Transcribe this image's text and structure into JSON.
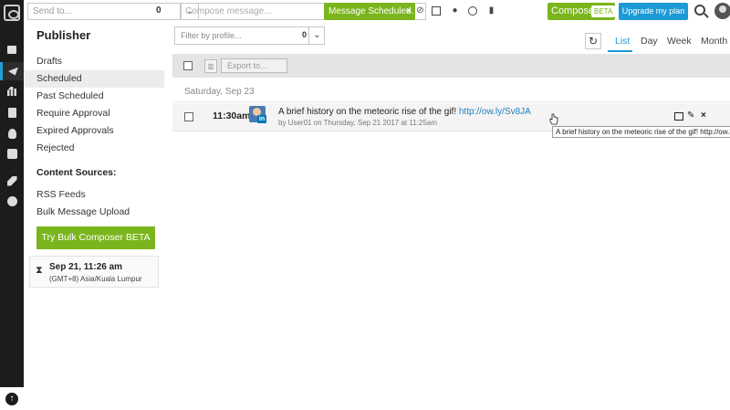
{
  "topbar": {
    "send_to_placeholder": "Send to...",
    "send_to_count": "0",
    "compose_placeholder": "Compose message...",
    "toast": "Message Scheduled.",
    "toast_close": "×",
    "composer_label": "Composer",
    "composer_badge": "BETA",
    "upgrade_label": "Upgrade my plan"
  },
  "sidebar": {
    "title": "Publisher",
    "items": [
      {
        "label": "Drafts"
      },
      {
        "label": "Scheduled"
      },
      {
        "label": "Past Scheduled"
      },
      {
        "label": "Require Approval"
      },
      {
        "label": "Expired Approvals"
      },
      {
        "label": "Rejected"
      }
    ],
    "active_item": "Scheduled",
    "content_sources_title": "Content Sources:",
    "sources": [
      {
        "label": "RSS Feeds"
      },
      {
        "label": "Bulk Message Upload"
      }
    ],
    "bulk_button": "Try Bulk Composer BETA",
    "timezone": {
      "datetime": "Sep 21, 11:26 am",
      "zone": "(GMT+8) Asia/Kuala Lumpur"
    }
  },
  "main": {
    "filter_placeholder": "Filter by profile...",
    "filter_count": "0",
    "views": [
      "List",
      "Day",
      "Week",
      "Month"
    ],
    "active_view": "List",
    "export_label": "Export to...",
    "day_header": "Saturday, Sep 23",
    "message": {
      "time": "11:30am",
      "text": "A brief history on the meteoric rise of the gif!",
      "link": "http://ow.ly/Sv8JA",
      "meta": "by User01 on Thursday, Sep 21 2017 at 11:25am",
      "network_badge": "in"
    },
    "tooltip": "A brief history on the meteoric rise of the gif! http://ow.ly/"
  },
  "colors": {
    "green": "#7ab51d",
    "blue": "#1c9ad6",
    "rail": "#1c1c1c"
  }
}
